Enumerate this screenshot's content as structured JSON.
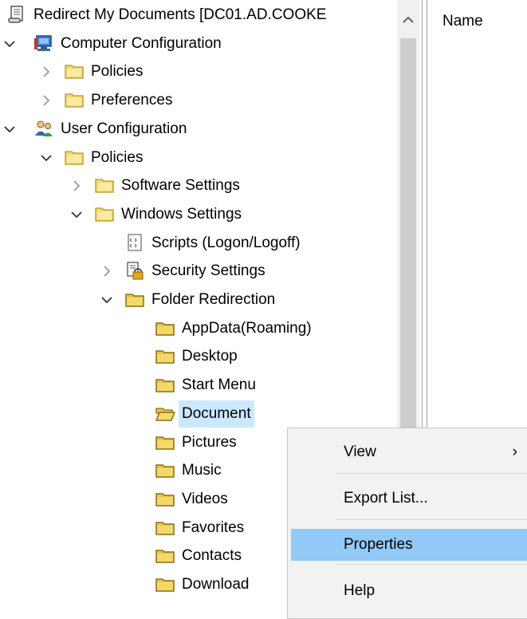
{
  "tree": {
    "items": [
      {
        "label": "Redirect My Documents [DC01.AD.COOKE",
        "icon": "policy-scroll-icon",
        "expander": "none",
        "level": 0
      },
      {
        "label": "Computer Configuration",
        "icon": "computer-icon",
        "expander": "expanded",
        "level": 0
      },
      {
        "label": "Policies",
        "icon": "folder-icon",
        "expander": "collapsed",
        "level": 1
      },
      {
        "label": "Preferences",
        "icon": "folder-icon",
        "expander": "collapsed",
        "level": 1
      },
      {
        "label": "User Configuration",
        "icon": "users-icon",
        "expander": "expanded",
        "level": 0
      },
      {
        "label": "Policies",
        "icon": "folder-icon",
        "expander": "expanded",
        "level": 1
      },
      {
        "label": "Software Settings",
        "icon": "folder-icon",
        "expander": "collapsed",
        "level": 2
      },
      {
        "label": "Windows Settings",
        "icon": "folder-icon",
        "expander": "expanded",
        "level": 2
      },
      {
        "label": "Scripts (Logon/Logoff)",
        "icon": "script-icon",
        "expander": "none",
        "level": 3
      },
      {
        "label": "Security Settings",
        "icon": "security-lock-icon",
        "expander": "collapsed",
        "level": 3
      },
      {
        "label": "Folder Redirection",
        "icon": "yellow-folder-icon",
        "expander": "expanded",
        "level": 3
      },
      {
        "label": "AppData(Roaming)",
        "icon": "yellow-folder-icon",
        "expander": "none",
        "level": 4
      },
      {
        "label": "Desktop",
        "icon": "yellow-folder-icon",
        "expander": "none",
        "level": 4
      },
      {
        "label": "Start Menu",
        "icon": "yellow-folder-icon",
        "expander": "none",
        "level": 4
      },
      {
        "label": "Document",
        "icon": "open-folder-icon",
        "expander": "none",
        "level": 4,
        "selected": true
      },
      {
        "label": "Pictures",
        "icon": "yellow-folder-icon",
        "expander": "none",
        "level": 4
      },
      {
        "label": "Music",
        "icon": "yellow-folder-icon",
        "expander": "none",
        "level": 4
      },
      {
        "label": "Videos",
        "icon": "yellow-folder-icon",
        "expander": "none",
        "level": 4
      },
      {
        "label": "Favorites",
        "icon": "yellow-folder-icon",
        "expander": "none",
        "level": 4
      },
      {
        "label": "Contacts",
        "icon": "yellow-folder-icon",
        "expander": "none",
        "level": 4
      },
      {
        "label": "Download",
        "icon": "yellow-folder-icon",
        "expander": "none",
        "level": 4
      }
    ]
  },
  "details": {
    "column_name": "Name"
  },
  "context_menu": {
    "items": [
      {
        "label": "View",
        "has_submenu": true,
        "submenu_glyph": "›"
      },
      {
        "label": "Export List..."
      },
      {
        "label": "Properties",
        "hover": true
      },
      {
        "label": "Help"
      }
    ]
  },
  "colors": {
    "selection": "#cce8ff",
    "menu_hover": "#91c9f7",
    "menu_background": "#f2f2f2",
    "folder_yellow": "#f4d96a"
  }
}
